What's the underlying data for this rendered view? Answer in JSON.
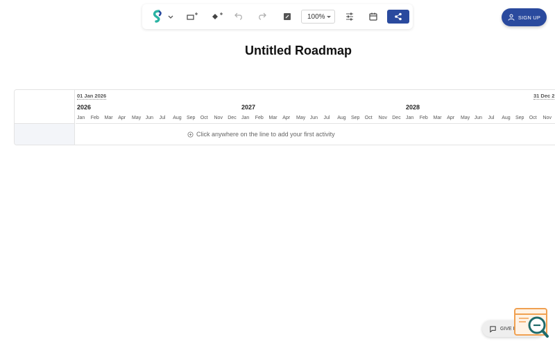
{
  "toolbar": {
    "zoom": "100%"
  },
  "header": {
    "signup_label": "SIGN UP"
  },
  "page": {
    "title": "Untitled Roadmap"
  },
  "timeline": {
    "start_date": "01 Jan 2026",
    "end_date": "31 Dec 2",
    "years": [
      {
        "label": "2026"
      },
      {
        "label": "2027"
      },
      {
        "label": "2028"
      }
    ],
    "months": [
      "Jan",
      "Feb",
      "Mar",
      "Apr",
      "May",
      "Jun",
      "Jul",
      "Aug",
      "Sep",
      "Oct",
      "Nov",
      "Dec",
      "Jan",
      "Feb",
      "Mar",
      "Apr",
      "May",
      "Jun",
      "Jul",
      "Aug",
      "Sep",
      "Oct",
      "Nov",
      "Dec",
      "Jan",
      "Feb",
      "Mar",
      "Apr",
      "May",
      "Jun",
      "Jul",
      "Aug",
      "Sep",
      "Oct",
      "Nov"
    ],
    "empty_hint": "Click anywhere on the line to add your first activity"
  },
  "feedback": {
    "label": "GIVE FEEDB"
  },
  "colors": {
    "accent": "#2a4a9e",
    "logo_teal": "#2bb3a3",
    "logo_navy": "#2a4a9e",
    "widget_orange": "#f0a050",
    "widget_teal": "#1f6b6b"
  },
  "icons": {
    "logo": "app-logo-icon",
    "shape": "add-shape-icon",
    "milestone": "add-milestone-icon",
    "undo": "undo-icon",
    "redo": "redo-icon",
    "edit": "edit-icon",
    "settings": "sliders-icon",
    "calendar": "calendar-icon",
    "share": "share-icon",
    "user": "user-icon",
    "add": "plus-circle-icon",
    "chat": "chat-icon",
    "widget": "search-widget-icon"
  }
}
